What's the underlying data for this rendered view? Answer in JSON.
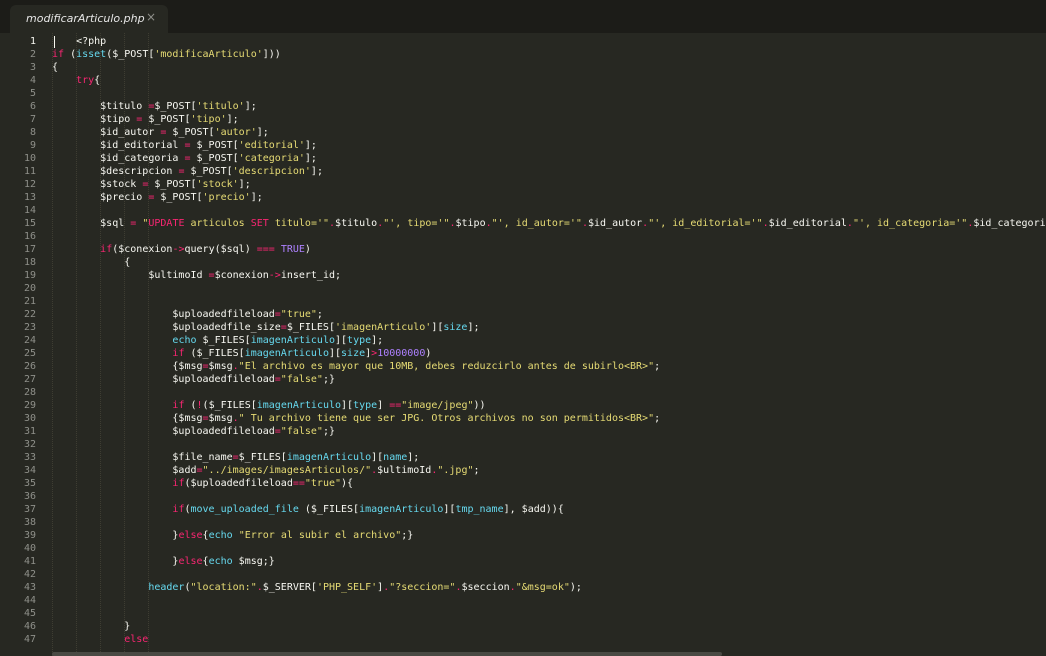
{
  "tab": {
    "filename": "modificarArticulo.php",
    "close_glyph": "×"
  },
  "colors": {
    "background": "#272822",
    "text": "#f8f8f2",
    "keyword": "#f92672",
    "string": "#e6db74",
    "builtin": "#66d9ef",
    "constant": "#ae81ff",
    "line_number": "#8f908a"
  },
  "editor": {
    "active_line": 1,
    "lines": [
      {
        "n": "1",
        "tokens": [
          [
            "    <?php",
            ""
          ]
        ]
      },
      {
        "n": "2",
        "tokens": [
          [
            "if",
            "k"
          ],
          [
            " (",
            ""
          ],
          [
            "isset",
            "v"
          ],
          [
            "($_POST[",
            ""
          ],
          [
            "'modificaArticulo'",
            "s"
          ],
          [
            "]))",
            ""
          ]
        ]
      },
      {
        "n": "3",
        "tokens": [
          [
            "{",
            ""
          ]
        ]
      },
      {
        "n": "4",
        "tokens": [
          [
            "    ",
            ""
          ],
          [
            "try",
            "k"
          ],
          [
            "{",
            ""
          ]
        ]
      },
      {
        "n": "5",
        "tokens": [
          [
            "",
            ""
          ]
        ]
      },
      {
        "n": "6",
        "tokens": [
          [
            "        $titulo ",
            ""
          ],
          [
            "=",
            "k"
          ],
          [
            "$_POST[",
            ""
          ],
          [
            "'titulo'",
            "s"
          ],
          [
            "];",
            ""
          ]
        ]
      },
      {
        "n": "7",
        "tokens": [
          [
            "        $tipo ",
            ""
          ],
          [
            "=",
            "k"
          ],
          [
            " $_POST[",
            ""
          ],
          [
            "'tipo'",
            "s"
          ],
          [
            "];",
            ""
          ]
        ]
      },
      {
        "n": "8",
        "tokens": [
          [
            "        $id_autor ",
            ""
          ],
          [
            "=",
            "k"
          ],
          [
            " $_POST[",
            ""
          ],
          [
            "'autor'",
            "s"
          ],
          [
            "];",
            ""
          ]
        ]
      },
      {
        "n": "9",
        "tokens": [
          [
            "        $id_editorial ",
            ""
          ],
          [
            "=",
            "k"
          ],
          [
            " $_POST[",
            ""
          ],
          [
            "'editorial'",
            "s"
          ],
          [
            "];",
            ""
          ]
        ]
      },
      {
        "n": "10",
        "tokens": [
          [
            "        $id_categoria ",
            ""
          ],
          [
            "=",
            "k"
          ],
          [
            " $_POST[",
            ""
          ],
          [
            "'categoria'",
            "s"
          ],
          [
            "];",
            ""
          ]
        ]
      },
      {
        "n": "11",
        "tokens": [
          [
            "        $descripcion ",
            ""
          ],
          [
            "=",
            "k"
          ],
          [
            " $_POST[",
            ""
          ],
          [
            "'descripcion'",
            "s"
          ],
          [
            "];",
            ""
          ]
        ]
      },
      {
        "n": "12",
        "tokens": [
          [
            "        $stock ",
            ""
          ],
          [
            "=",
            "k"
          ],
          [
            " $_POST[",
            ""
          ],
          [
            "'stock'",
            "s"
          ],
          [
            "];",
            ""
          ]
        ]
      },
      {
        "n": "13",
        "tokens": [
          [
            "        $precio ",
            ""
          ],
          [
            "=",
            "k"
          ],
          [
            " $_POST[",
            ""
          ],
          [
            "'precio'",
            "s"
          ],
          [
            "];",
            ""
          ]
        ]
      },
      {
        "n": "14",
        "tokens": [
          [
            "",
            ""
          ]
        ]
      },
      {
        "n": "15",
        "tokens": [
          [
            "        $sql ",
            ""
          ],
          [
            "=",
            "k"
          ],
          [
            " ",
            ""
          ],
          [
            "\"",
            "s"
          ],
          [
            "UPDATE",
            "k"
          ],
          [
            " articulos ",
            "s"
          ],
          [
            "SET",
            "k"
          ],
          [
            " titulo='\"",
            "s"
          ],
          [
            ".",
            "k"
          ],
          [
            "$titulo",
            ""
          ],
          [
            ".",
            "k"
          ],
          [
            "\"', tipo='\"",
            "s"
          ],
          [
            ".",
            "k"
          ],
          [
            "$tipo",
            ""
          ],
          [
            ".",
            "k"
          ],
          [
            "\"', id_autor='\"",
            "s"
          ],
          [
            ".",
            "k"
          ],
          [
            "$id_autor",
            ""
          ],
          [
            ".",
            "k"
          ],
          [
            "\"', id_editorial='\"",
            "s"
          ],
          [
            ".",
            "k"
          ],
          [
            "$id_editorial",
            ""
          ],
          [
            ".",
            "k"
          ],
          [
            "\"', id_categoria='\"",
            "s"
          ],
          [
            ".",
            "k"
          ],
          [
            "$id_categoria",
            ""
          ]
        ]
      },
      {
        "n": "16",
        "tokens": [
          [
            "",
            ""
          ]
        ]
      },
      {
        "n": "17",
        "tokens": [
          [
            "        ",
            ""
          ],
          [
            "if",
            "k"
          ],
          [
            "($conexion",
            ""
          ],
          [
            "->",
            "k"
          ],
          [
            "query($sql) ",
            ""
          ],
          [
            "===",
            "k"
          ],
          [
            " ",
            ""
          ],
          [
            "TRUE",
            "n"
          ],
          [
            ")",
            ""
          ]
        ]
      },
      {
        "n": "18",
        "tokens": [
          [
            "            {",
            ""
          ]
        ]
      },
      {
        "n": "19",
        "tokens": [
          [
            "                $ultimoId ",
            ""
          ],
          [
            "=",
            "k"
          ],
          [
            "$conexion",
            ""
          ],
          [
            "->",
            "k"
          ],
          [
            "insert_id;",
            ""
          ]
        ]
      },
      {
        "n": "20",
        "tokens": [
          [
            "",
            ""
          ]
        ]
      },
      {
        "n": "21",
        "tokens": [
          [
            "",
            ""
          ]
        ]
      },
      {
        "n": "22",
        "tokens": [
          [
            "                    $uploadedfileload",
            ""
          ],
          [
            "=",
            "k"
          ],
          [
            "\"true\"",
            "s"
          ],
          [
            ";",
            ""
          ]
        ]
      },
      {
        "n": "23",
        "tokens": [
          [
            "                    $uploadedfile_size",
            ""
          ],
          [
            "=",
            "k"
          ],
          [
            "$_FILES[",
            ""
          ],
          [
            "'imagenArticulo'",
            "s"
          ],
          [
            "][",
            ""
          ],
          [
            "size",
            "v"
          ],
          [
            "];",
            ""
          ]
        ]
      },
      {
        "n": "24",
        "tokens": [
          [
            "                    ",
            ""
          ],
          [
            "echo",
            "v"
          ],
          [
            " $_FILES[",
            ""
          ],
          [
            "imagenArticulo",
            "v"
          ],
          [
            "][",
            ""
          ],
          [
            "type",
            "v"
          ],
          [
            "];",
            ""
          ]
        ]
      },
      {
        "n": "25",
        "tokens": [
          [
            "                    ",
            ""
          ],
          [
            "if",
            "k"
          ],
          [
            " ($_FILES[",
            ""
          ],
          [
            "imagenArticulo",
            "v"
          ],
          [
            "][",
            ""
          ],
          [
            "size",
            "v"
          ],
          [
            "]",
            ""
          ],
          [
            ">",
            "k"
          ],
          [
            "10000000",
            "n"
          ],
          [
            ")",
            ""
          ]
        ]
      },
      {
        "n": "26",
        "tokens": [
          [
            "                    {$msg",
            ""
          ],
          [
            "=",
            "k"
          ],
          [
            "$msg",
            ""
          ],
          [
            ".",
            "k"
          ],
          [
            "\"El archivo es mayor que 10MB, debes reduzcirlo antes de subirlo<BR>\"",
            "s"
          ],
          [
            ";",
            ""
          ]
        ]
      },
      {
        "n": "27",
        "tokens": [
          [
            "                    $uploadedfileload",
            ""
          ],
          [
            "=",
            "k"
          ],
          [
            "\"false\"",
            "s"
          ],
          [
            ";}",
            ""
          ]
        ]
      },
      {
        "n": "28",
        "tokens": [
          [
            "",
            ""
          ]
        ]
      },
      {
        "n": "29",
        "tokens": [
          [
            "                    ",
            ""
          ],
          [
            "if",
            "k"
          ],
          [
            " (",
            ""
          ],
          [
            "!",
            "k"
          ],
          [
            "($_FILES[",
            ""
          ],
          [
            "imagenArticulo",
            "v"
          ],
          [
            "][",
            ""
          ],
          [
            "type",
            "v"
          ],
          [
            "] ",
            ""
          ],
          [
            "==",
            "k"
          ],
          [
            "\"image/jpeg\"",
            "s"
          ],
          [
            "))",
            ""
          ]
        ]
      },
      {
        "n": "30",
        "tokens": [
          [
            "                    {$msg",
            ""
          ],
          [
            "=",
            "k"
          ],
          [
            "$msg",
            ""
          ],
          [
            ".",
            "k"
          ],
          [
            "\" Tu archivo tiene que ser JPG. Otros archivos no son permitidos<BR>\"",
            "s"
          ],
          [
            ";",
            ""
          ]
        ]
      },
      {
        "n": "31",
        "tokens": [
          [
            "                    $uploadedfileload",
            ""
          ],
          [
            "=",
            "k"
          ],
          [
            "\"false\"",
            "s"
          ],
          [
            ";}",
            ""
          ]
        ]
      },
      {
        "n": "32",
        "tokens": [
          [
            "",
            ""
          ]
        ]
      },
      {
        "n": "33",
        "tokens": [
          [
            "                    $file_name",
            ""
          ],
          [
            "=",
            "k"
          ],
          [
            "$_FILES[",
            ""
          ],
          [
            "imagenArticulo",
            "v"
          ],
          [
            "][",
            ""
          ],
          [
            "name",
            "v"
          ],
          [
            "];",
            ""
          ]
        ]
      },
      {
        "n": "34",
        "tokens": [
          [
            "                    $add",
            ""
          ],
          [
            "=",
            "k"
          ],
          [
            "\"../images/imagesArticulos/\"",
            "s"
          ],
          [
            ".",
            "k"
          ],
          [
            "$ultimoId",
            ""
          ],
          [
            ".",
            "k"
          ],
          [
            "\".jpg\"",
            "s"
          ],
          [
            ";",
            ""
          ]
        ]
      },
      {
        "n": "35",
        "tokens": [
          [
            "                    ",
            ""
          ],
          [
            "if",
            "k"
          ],
          [
            "($uploadedfileload",
            ""
          ],
          [
            "==",
            "k"
          ],
          [
            "\"true\"",
            "s"
          ],
          [
            "){",
            ""
          ]
        ]
      },
      {
        "n": "36",
        "tokens": [
          [
            "",
            ""
          ]
        ]
      },
      {
        "n": "37",
        "tokens": [
          [
            "                    ",
            ""
          ],
          [
            "if",
            "k"
          ],
          [
            "(",
            ""
          ],
          [
            "move_uploaded_file",
            "v"
          ],
          [
            " ($_FILES[",
            ""
          ],
          [
            "imagenArticulo",
            "v"
          ],
          [
            "][",
            ""
          ],
          [
            "tmp_name",
            "v"
          ],
          [
            "], $add)){",
            ""
          ]
        ]
      },
      {
        "n": "38",
        "tokens": [
          [
            "",
            ""
          ]
        ]
      },
      {
        "n": "39",
        "tokens": [
          [
            "                    }",
            ""
          ],
          [
            "else",
            "k"
          ],
          [
            "{",
            ""
          ],
          [
            "echo",
            "v"
          ],
          [
            " ",
            ""
          ],
          [
            "\"Error al subir el archivo\"",
            "s"
          ],
          [
            ";}",
            ""
          ]
        ]
      },
      {
        "n": "40",
        "tokens": [
          [
            "",
            ""
          ]
        ]
      },
      {
        "n": "41",
        "tokens": [
          [
            "                    }",
            ""
          ],
          [
            "else",
            "k"
          ],
          [
            "{",
            ""
          ],
          [
            "echo",
            "v"
          ],
          [
            " $msg;}",
            ""
          ]
        ]
      },
      {
        "n": "42",
        "tokens": [
          [
            "",
            ""
          ]
        ]
      },
      {
        "n": "43",
        "tokens": [
          [
            "                ",
            ""
          ],
          [
            "header",
            "v"
          ],
          [
            "(",
            ""
          ],
          [
            "\"location:\"",
            "s"
          ],
          [
            ".",
            "k"
          ],
          [
            "$_SERVER[",
            ""
          ],
          [
            "'PHP_SELF'",
            "s"
          ],
          [
            "]",
            ""
          ],
          [
            ".",
            "k"
          ],
          [
            "\"?seccion=\"",
            "s"
          ],
          [
            ".",
            "k"
          ],
          [
            "$seccion",
            ""
          ],
          [
            ".",
            "k"
          ],
          [
            "\"&msg=ok\"",
            "s"
          ],
          [
            ");",
            ""
          ]
        ]
      },
      {
        "n": "44",
        "tokens": [
          [
            "",
            ""
          ]
        ]
      },
      {
        "n": "45",
        "tokens": [
          [
            "",
            ""
          ]
        ]
      },
      {
        "n": "46",
        "tokens": [
          [
            "            }",
            ""
          ]
        ]
      },
      {
        "n": "47",
        "tokens": [
          [
            "            ",
            ""
          ],
          [
            "else",
            "k"
          ]
        ]
      }
    ]
  }
}
